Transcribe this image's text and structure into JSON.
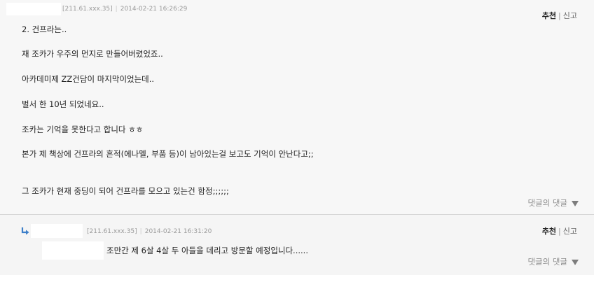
{
  "comment": {
    "ip": "[211.61.xxx.35]",
    "separator": "|",
    "datetime": "2014-02-21 16:26:29",
    "recommend_label": "추천",
    "report_label": "신고",
    "lines": [
      "2. 건프라는..",
      "재 조카가 우주의 먼지로 만들어버렸었죠..",
      "아카데미제 ZZ건담이 마지막이었는데..",
      "벌서 한 10년 되었네요..",
      "조카는 기억을 못한다고 합니다 ㅎㅎ",
      "본가 제 책상에 건프라의 흔적(에나멜, 부품 등)이 남아있는걸 보고도 기억이 안난다고;;",
      "그 조카가 현재 중딩이 되어 건프라를 모으고 있는건 함정;;;;;;"
    ],
    "reply_link": "댓글의 댓글"
  },
  "reply": {
    "ip": "[211.61.xxx.35]",
    "separator": "|",
    "datetime": "2014-02-21 16:31:20",
    "recommend_label": "추천",
    "report_label": "신고",
    "text": "조만간 제 6살 4살 두 아들을 데리고 방문할 예정입니다......",
    "reply_link": "댓글의 댓글"
  },
  "colors": {
    "reply_arrow": "#3d7fc9",
    "meta": "#9a9a9a",
    "divider": "#d6d6d6"
  },
  "icons": {
    "reply_indicator": "reply-arrow-icon",
    "expand": "triangle-down-icon"
  }
}
